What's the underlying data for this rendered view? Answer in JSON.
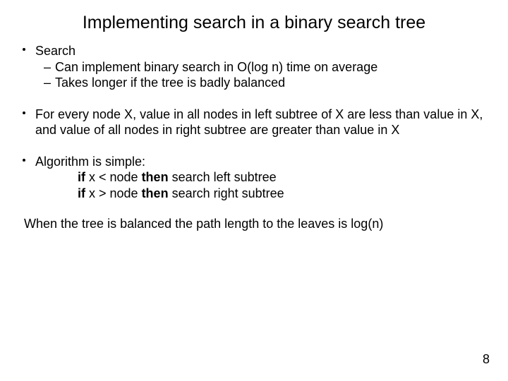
{
  "title": "Implementing search in a  binary search tree",
  "bullets": {
    "b1_title": "Search",
    "b1_sub1": "Can implement binary search in O(log n) time on average",
    "b1_sub2": "Takes longer if the tree is badly balanced",
    "b2": "For every node X, value in all nodes in left subtree of X are less than value in X, and value of all nodes in right subtree are greater than value in X",
    "b3_title": "Algorithm is simple:",
    "b3_if1": "if",
    "b3_cond1": " x < node ",
    "b3_then1": "then",
    "b3_act1": " search left subtree",
    "b3_if2": "if",
    "b3_cond2": " x > node ",
    "b3_then2": "then",
    "b3_act2": " search right subtree"
  },
  "closing": "When the tree is balanced the path length to the leaves is log(n)",
  "page_number": "8",
  "dash": "–"
}
